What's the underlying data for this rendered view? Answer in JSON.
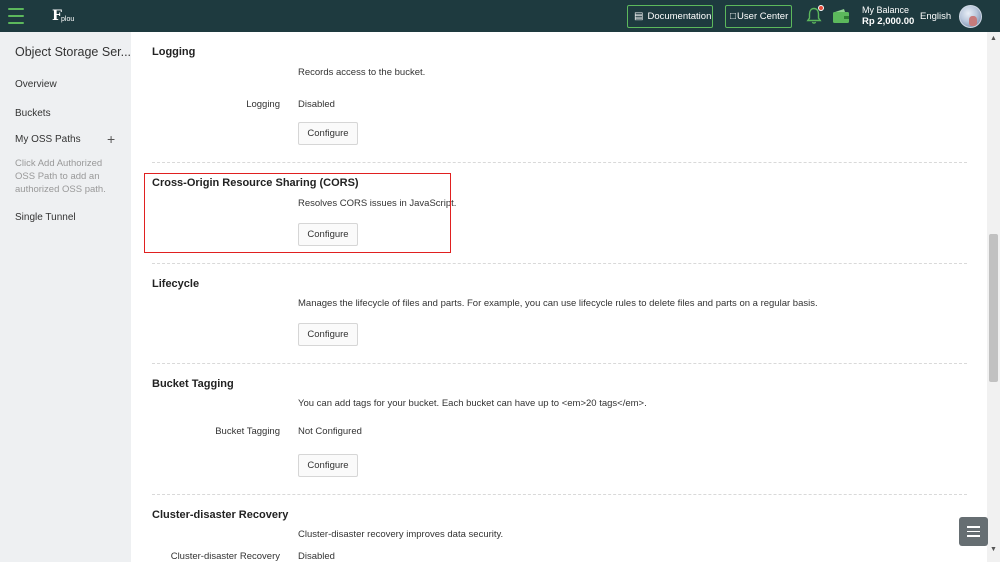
{
  "topbar": {
    "logo_text": "plou",
    "documentation_label": "Documentation",
    "user_center_label": "User Center",
    "balance_label": "My Balance",
    "balance_amount": "Rp 2,000.00",
    "language": "English",
    "accent_color": "#5cb85c",
    "bar_color": "#1e3a3f"
  },
  "sidebar": {
    "title": "Object Storage Ser...",
    "items": [
      {
        "label": "Overview"
      },
      {
        "label": "Buckets"
      },
      {
        "label": "My OSS Paths"
      },
      {
        "label": "Single Tunnel"
      }
    ],
    "add_label": "+",
    "hint": "Click Add Authorized OSS Path to add an authorized OSS path."
  },
  "sections": {
    "logging": {
      "title": "Logging",
      "description": "Records access to the bucket.",
      "row_label": "Logging",
      "row_value": "Disabled",
      "button": "Configure"
    },
    "cors": {
      "title": "Cross-Origin Resource Sharing (CORS)",
      "description": "Resolves CORS issues in JavaScript.",
      "button": "Configure"
    },
    "lifecycle": {
      "title": "Lifecycle",
      "description": "Manages the lifecycle of files and parts. For example, you can use lifecycle rules to delete files and parts on a regular basis.",
      "button": "Configure"
    },
    "tagging": {
      "title": "Bucket Tagging",
      "description": "You can add tags for your bucket. Each bucket can have up to <em>20 tags</em>.",
      "row_label": "Bucket Tagging",
      "row_value": "Not Configured",
      "button": "Configure"
    },
    "cluster": {
      "title": "Cluster-disaster Recovery",
      "description": "Cluster-disaster recovery improves data security.",
      "row_label": "Cluster-disaster Recovery",
      "row_value": "Disabled"
    }
  },
  "highlight_color": "#e02020"
}
